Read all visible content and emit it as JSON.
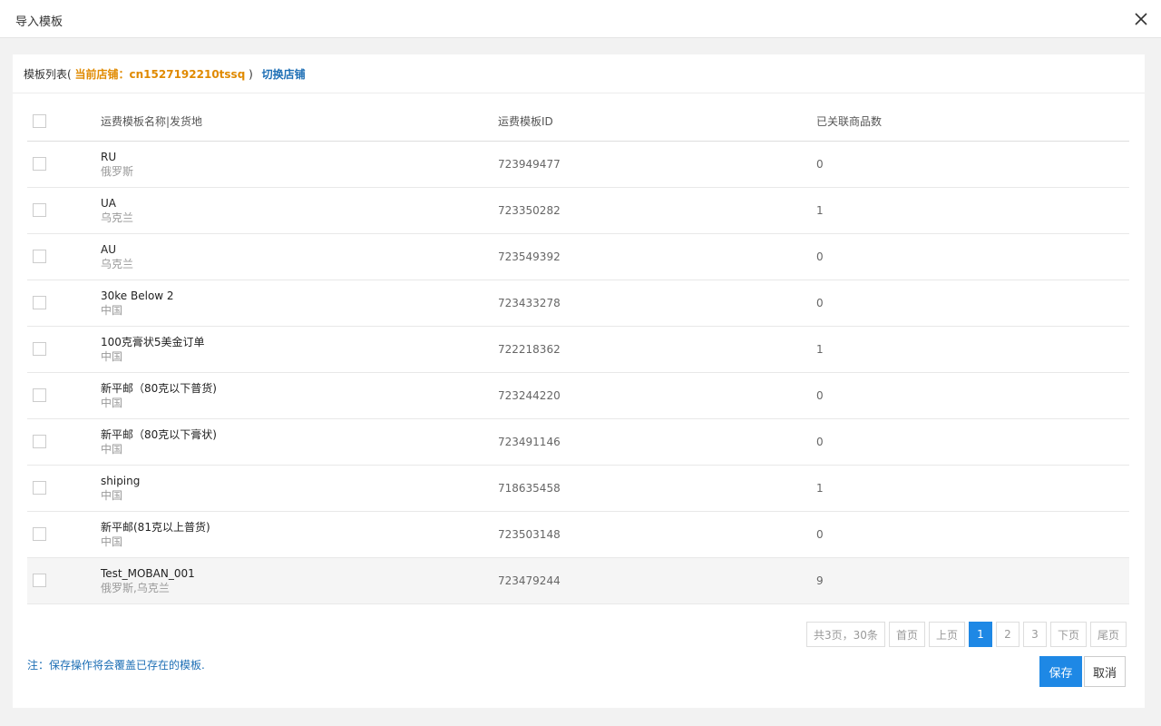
{
  "modal": {
    "title": "导入模板",
    "close_icon": "close-icon"
  },
  "panel": {
    "list_label": "模板列表(",
    "shop_label": "当前店铺：cn1527192210tssq",
    "close_paren": ")",
    "switch_link": "切换店铺"
  },
  "table": {
    "headers": [
      "运费模板名称|发货地",
      "运费模板ID",
      "已关联商品数"
    ],
    "rows": [
      {
        "name": "RU",
        "origin": "俄罗斯",
        "id": "723949477",
        "count": "0"
      },
      {
        "name": "UA",
        "origin": "乌克兰",
        "id": "723350282",
        "count": "1"
      },
      {
        "name": "AU",
        "origin": "乌克兰",
        "id": "723549392",
        "count": "0"
      },
      {
        "name": "30ke Below 2",
        "origin": "中国",
        "id": "723433278",
        "count": "0"
      },
      {
        "name": "100克膏状5美金订单",
        "origin": "中国",
        "id": "722218362",
        "count": "1"
      },
      {
        "name": "新平邮（80克以下普货)",
        "origin": "中国",
        "id": "723244220",
        "count": "0"
      },
      {
        "name": "新平邮（80克以下膏状)",
        "origin": "中国",
        "id": "723491146",
        "count": "0"
      },
      {
        "name": "shiping",
        "origin": "中国",
        "id": "718635458",
        "count": "1"
      },
      {
        "name": "新平邮(81克以上普货)",
        "origin": "中国",
        "id": "723503148",
        "count": "0"
      },
      {
        "name": "Test_MOBAN_001",
        "origin": "俄罗斯,乌克兰",
        "id": "723479244",
        "count": "9"
      }
    ]
  },
  "pagination": {
    "summary": "共3页，30条",
    "first": "首页",
    "prev": "上页",
    "pages": [
      "1",
      "2",
      "3"
    ],
    "current": "1",
    "next": "下页",
    "last": "尾页"
  },
  "footer": {
    "note": "注：保存操作将会覆盖已存在的模板.",
    "save": "保存",
    "cancel": "取消"
  },
  "colors": {
    "accent": "#1e88e5",
    "shop_highlight": "#e08a00",
    "link": "#1e6fb5"
  }
}
